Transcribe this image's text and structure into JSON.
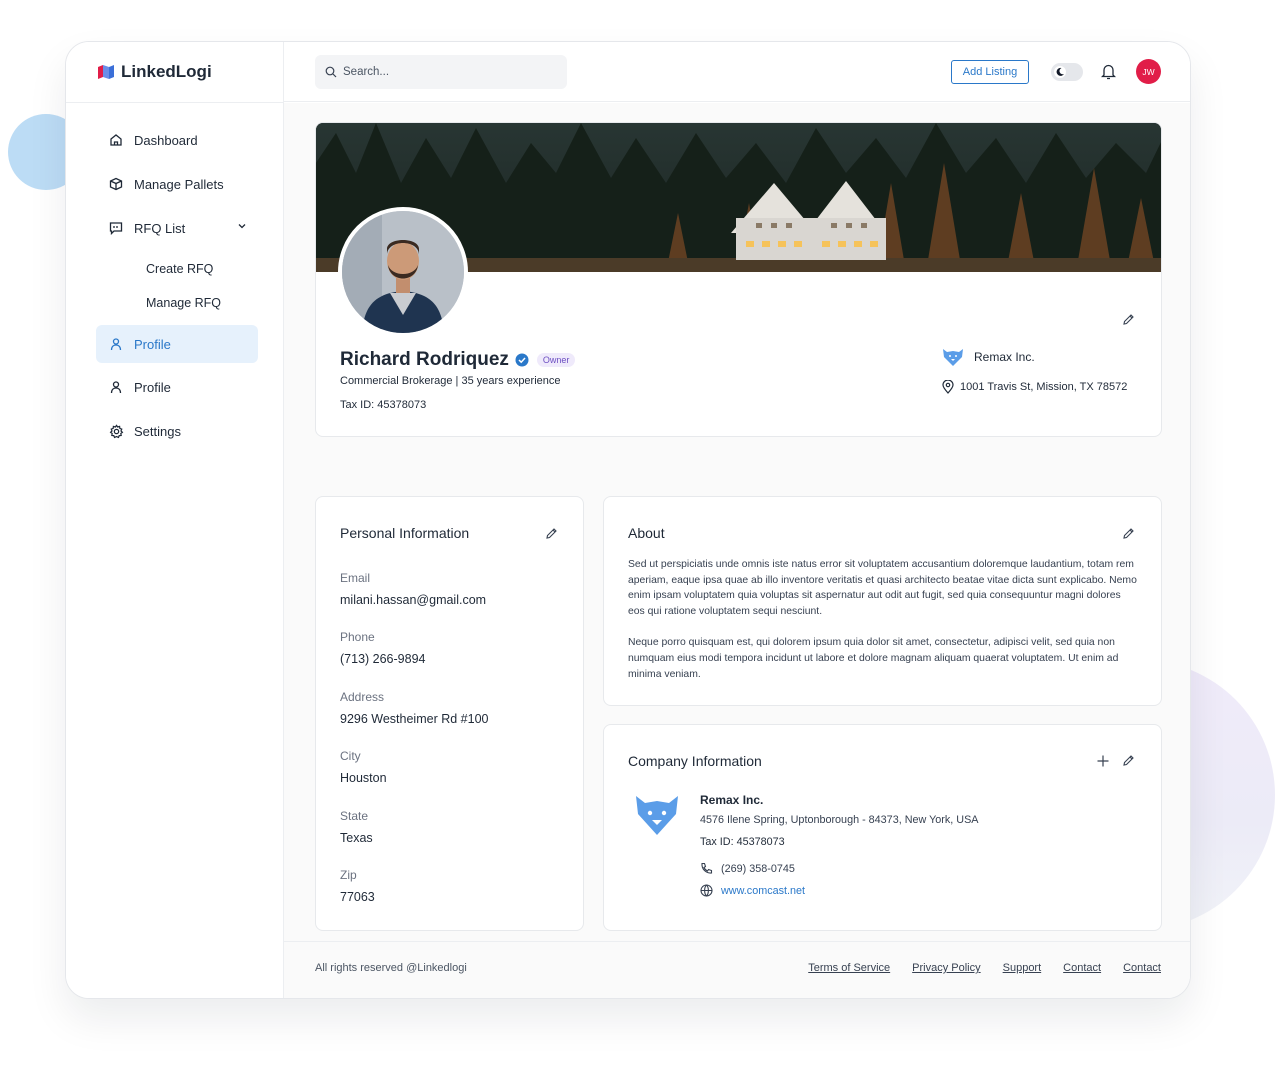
{
  "app": {
    "logo_text": "LinkedLogi"
  },
  "sidebar": {
    "items": [
      {
        "label": "Dashboard",
        "icon": "home-icon"
      },
      {
        "label": "Manage Pallets",
        "icon": "box-icon"
      },
      {
        "label": "RFQ List",
        "icon": "quote-icon"
      },
      {
        "label": "Create RFQ"
      },
      {
        "label": "Manage RFQ"
      },
      {
        "label": "Profile",
        "icon": "user-icon",
        "active": true
      },
      {
        "label": "Profile",
        "icon": "user-icon"
      },
      {
        "label": "Settings",
        "icon": "gear-icon"
      }
    ]
  },
  "header": {
    "search_placeholder": "Search...",
    "add_listing_label": "Add Listing",
    "avatar_initials": "JW"
  },
  "profile": {
    "name": "Richard Rodriquez",
    "badge": "Owner",
    "subtitle": "Commercial Brokerage | 35 years experience",
    "tax_label": "Tax ID:",
    "tax_value": "45378073",
    "company": "Remax Inc.",
    "address": "1001 Travis St, Mission, TX 78572"
  },
  "personal_info": {
    "title": "Personal Information",
    "fields": [
      {
        "label": "Email",
        "value": "milani.hassan@gmail.com"
      },
      {
        "label": "Phone",
        "value": "(713) 266-9894"
      },
      {
        "label": "Address",
        "value": "9296 Westheimer Rd #100"
      },
      {
        "label": "City",
        "value": "Houston"
      },
      {
        "label": "State",
        "value": "Texas"
      },
      {
        "label": "Zip",
        "value": "77063"
      }
    ]
  },
  "about": {
    "title": "About",
    "paragraph_1": "Sed ut perspiciatis unde omnis iste natus error sit voluptatem accusantium doloremque laudantium, totam rem aperiam, eaque ipsa quae ab illo inventore veritatis et quasi architecto beatae vitae dicta sunt explicabo. Nemo enim ipsam voluptatem quia voluptas sit aspernatur aut odit aut fugit, sed quia consequuntur magni dolores eos qui ratione voluptatem sequi nesciunt.",
    "paragraph_2": "Neque porro quisquam est, qui dolorem ipsum quia dolor sit amet, consectetur, adipisci velit, sed quia non numquam eius modi tempora incidunt ut labore et dolore magnam aliquam quaerat voluptatem. Ut enim ad minima veniam."
  },
  "company_info": {
    "title": "Company Information",
    "name": "Remax Inc.",
    "address": "4576 Ilene Spring, Uptonborough - 84373, New York, USA",
    "tax_label": "Tax ID:",
    "tax_value": "45378073",
    "phone": "(269) 358-0745",
    "website": "www.comcast.net"
  },
  "footer": {
    "copyright": "All rights reserved @Linkedlogi",
    "links": [
      "Terms of Service",
      "Privacy Policy",
      "Support",
      "Contact",
      "Contact"
    ]
  },
  "colors": {
    "accent": "#2a78c9",
    "active_bg": "#e6f1fc",
    "avatar_bg": "#e11d48",
    "badge_text": "#6d4fc2",
    "brand_icon": "#5b9de8"
  }
}
